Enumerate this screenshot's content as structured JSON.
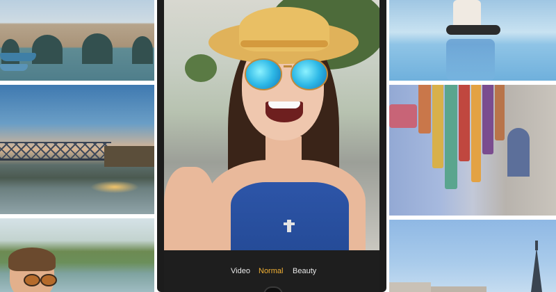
{
  "camera": {
    "modes": [
      "Video",
      "Normal",
      "Beauty"
    ],
    "active_mode": "Normal"
  },
  "colors": {
    "accent": "#f2b134",
    "mode_bar_bg": "#1e1e1e",
    "phone_frame": "#1c1c1c"
  },
  "gallery": {
    "left_tiles": [
      "stone-bridge-photo",
      "river-bridge-sunset-photo",
      "boy-sunglasses-photo"
    ],
    "right_tiles": [
      "yoga-pool-photo",
      "market-textiles-photo",
      "paris-eiffel-photo"
    ]
  }
}
